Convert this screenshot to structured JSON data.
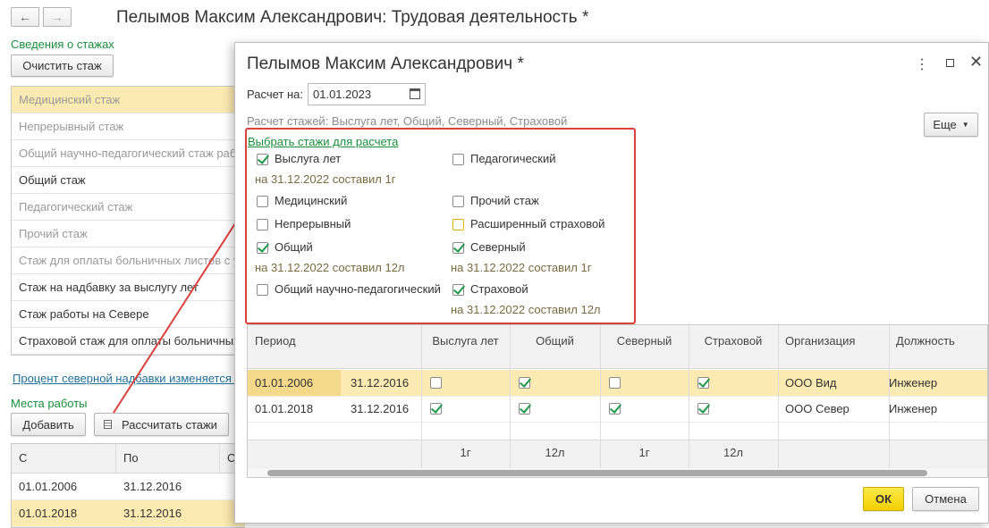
{
  "window": {
    "title": "Пелымов Максим Александрович: Трудовая деятельность *"
  },
  "nav": {
    "back": "←",
    "forward": "→"
  },
  "left": {
    "section_title": "Сведения о стажах",
    "clear_button": "Очистить стаж",
    "list": [
      {
        "label": "Медицинский стаж",
        "gray": true,
        "selected": true
      },
      {
        "label": "Непрерывный стаж",
        "gray": true
      },
      {
        "label": "Общий научно-педагогический стаж работы",
        "gray": true
      },
      {
        "label": "Общий стаж",
        "gray": false
      },
      {
        "label": "Педагогический стаж",
        "gray": true
      },
      {
        "label": "Прочий стаж",
        "gray": true
      },
      {
        "label": "Стаж для оплаты больничных листов с у",
        "gray": true
      },
      {
        "label": "Стаж на надбавку за выслугу лет",
        "gray": false
      },
      {
        "label": "Стаж работы на Севере",
        "gray": false
      },
      {
        "label": "Страховой стаж для оплаты больничных",
        "gray": false
      }
    ],
    "northern_link": "Процент северной надбавки изменяется автоматически",
    "places_title": "Места работы",
    "add_button": "Добавить",
    "calc_button": "Рассчитать стажи",
    "places_headers": [
      "С",
      "По",
      "С"
    ],
    "places_rows": [
      {
        "from": "01.01.2006",
        "to": "31.12.2016",
        "selected": false
      },
      {
        "from": "01.01.2018",
        "to": "31.12.2016",
        "selected": true
      }
    ]
  },
  "dialog": {
    "title": "Пелымов Максим Александрович *",
    "calc_date_label": "Расчет на:",
    "calc_date_value": "01.01.2023",
    "calc_summary": "Расчет стажей: Выслуга лет, Общий, Северный, Страховой",
    "more_button": "Еще",
    "choose_link": "Выбрать стажи для расчета",
    "options": [
      {
        "label": "Выслуга лет",
        "checked": true,
        "note": "на 31.12.2022 составил 1г"
      },
      {
        "label": "Педагогический",
        "checked": false,
        "note": ""
      },
      {
        "label": "Медицинский",
        "checked": false,
        "note": ""
      },
      {
        "label": "Прочий стаж",
        "checked": false,
        "note": ""
      },
      {
        "label": "Непрерывный",
        "checked": false,
        "note": ""
      },
      {
        "label": "Расширенный страховой",
        "checked": false,
        "note": ""
      },
      {
        "label": "Общий",
        "checked": true,
        "note": "на 31.12.2022 составил 12л"
      },
      {
        "label": "Северный",
        "checked": true,
        "note": "на 31.12.2022 составил 1г"
      },
      {
        "label": "Общий научно-педагогический",
        "checked": false,
        "note": ""
      },
      {
        "label": "Страховой",
        "checked": true,
        "note": "на 31.12.2022 составил 12л"
      }
    ],
    "table": {
      "headers": [
        "Период",
        "Выслуга лет",
        "Общий",
        "Северный",
        "Страховой",
        "Организация",
        "Должность"
      ],
      "rows": [
        {
          "from": "01.01.2006",
          "to": "31.12.2016",
          "checks": [
            false,
            true,
            false,
            true
          ],
          "org": "ООО Вид",
          "position": "Инженер",
          "selected": true
        },
        {
          "from": "01.01.2018",
          "to": "31.12.2016",
          "checks": [
            true,
            true,
            true,
            true
          ],
          "org": "ООО Север",
          "position": "Инженер",
          "selected": false
        }
      ],
      "totals": [
        "1г",
        "12л",
        "1г",
        "12л"
      ]
    },
    "ok_button": "ОК",
    "cancel_button": "Отмена"
  },
  "colors": {
    "accent_green": "#1a8f3c",
    "selection": "#fbeab1",
    "highlight_box": "#d9413c",
    "ok_yellow": "#f5d800"
  }
}
